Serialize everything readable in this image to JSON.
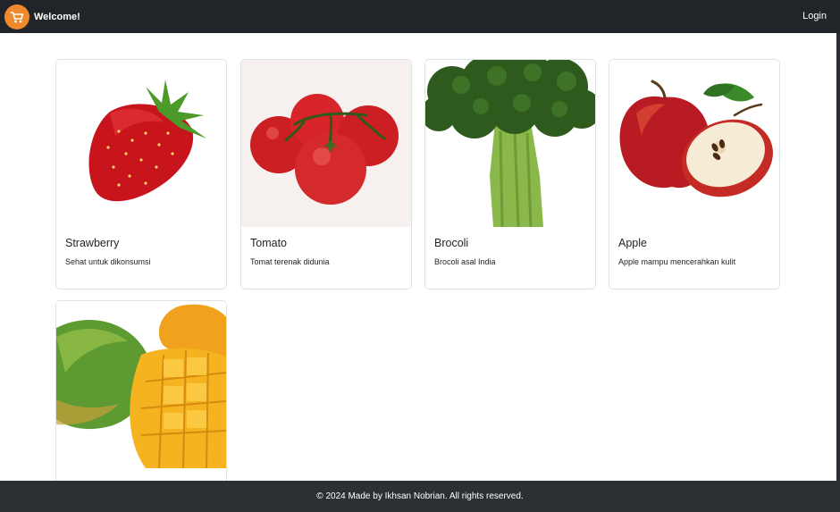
{
  "navbar": {
    "brand": "Welcome!",
    "login": "Login",
    "logo_icon": "shopping-cart-icon",
    "logo_color": "#f0892c",
    "background": "#212529"
  },
  "products": [
    {
      "title": "Strawberry",
      "description": "Sehat untuk dikonsumsi"
    },
    {
      "title": "Tomato",
      "description": "Tomat terenak didunia"
    },
    {
      "title": "Brocoli",
      "description": "Brocoli asal India"
    },
    {
      "title": "Apple",
      "description": "Apple mampu mencerahkan kulit"
    },
    {
      "title": "",
      "description": ""
    }
  ],
  "footer": {
    "text": "© 2024 Made by Ikhsan Nobrian. All rights reserved.",
    "background": "#2b3035"
  }
}
